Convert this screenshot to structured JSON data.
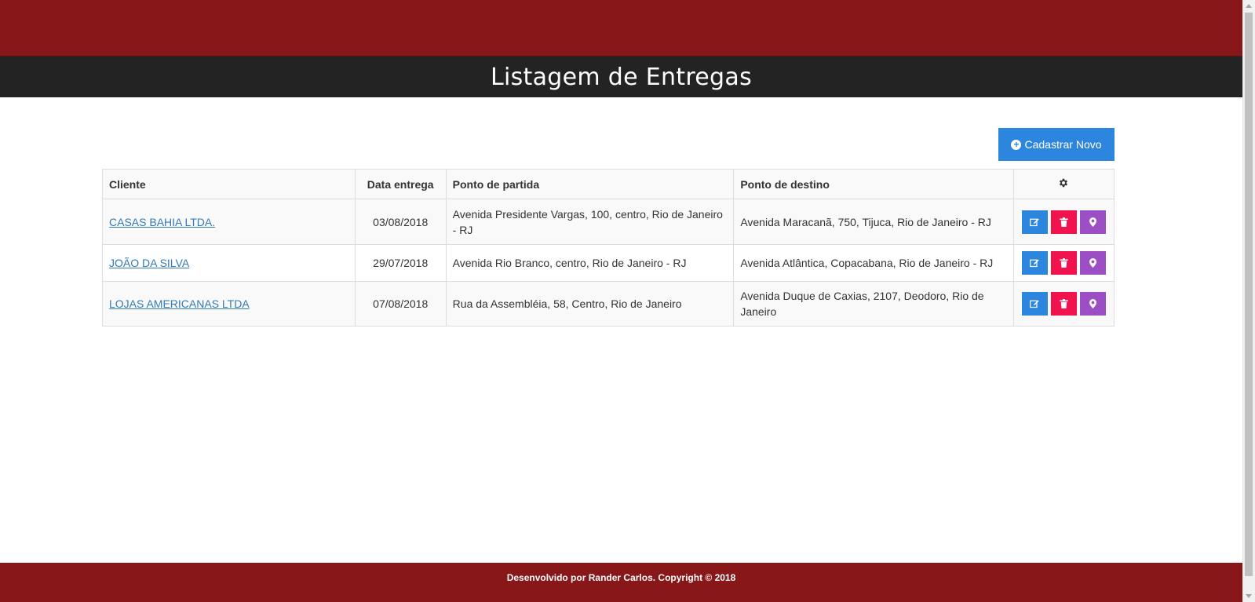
{
  "header": {
    "title": "Listagem de Entregas"
  },
  "toolbar": {
    "new_button_label": "Cadastrar Novo",
    "new_button_icon": "plus-circle-icon"
  },
  "table": {
    "columns": {
      "client": "Cliente",
      "date": "Data entrega",
      "origin": "Ponto de partida",
      "destination": "Ponto de destino",
      "actions_icon": "gear-icon"
    },
    "rows": [
      {
        "client": "CASAS BAHIA LTDA.",
        "date": "03/08/2018",
        "origin": "Avenida Presidente Vargas, 100, centro, Rio de Janeiro - RJ",
        "destination": "Avenida Maracanã, 750, Tijuca, Rio de Janeiro - RJ"
      },
      {
        "client": "JOÃO DA SILVA",
        "date": "29/07/2018",
        "origin": "Avenida Rio Branco, centro, Rio de Janeiro - RJ",
        "destination": "Avenida Atlântica, Copacabana, Rio de Janeiro - RJ"
      },
      {
        "client": "LOJAS AMERICANAS LTDA",
        "date": "07/08/2018",
        "origin": "Rua da Assembléia, 58, Centro, Rio de Janeiro",
        "destination": "Avenida Duque de Caxias, 2107, Deodoro, Rio de Janeiro"
      }
    ],
    "row_actions": [
      "edit-icon",
      "trash-icon",
      "map-marker-icon"
    ]
  },
  "footer": {
    "text": "Desenvolvido por Rander Carlos. Copyright © 2018"
  },
  "colors": {
    "brand_red": "#88171a",
    "title_bar": "#232323",
    "primary_blue": "#2d86de",
    "danger_pink": "#f0134d",
    "map_purple": "#9c4fc4",
    "link_blue": "#337ab7"
  }
}
